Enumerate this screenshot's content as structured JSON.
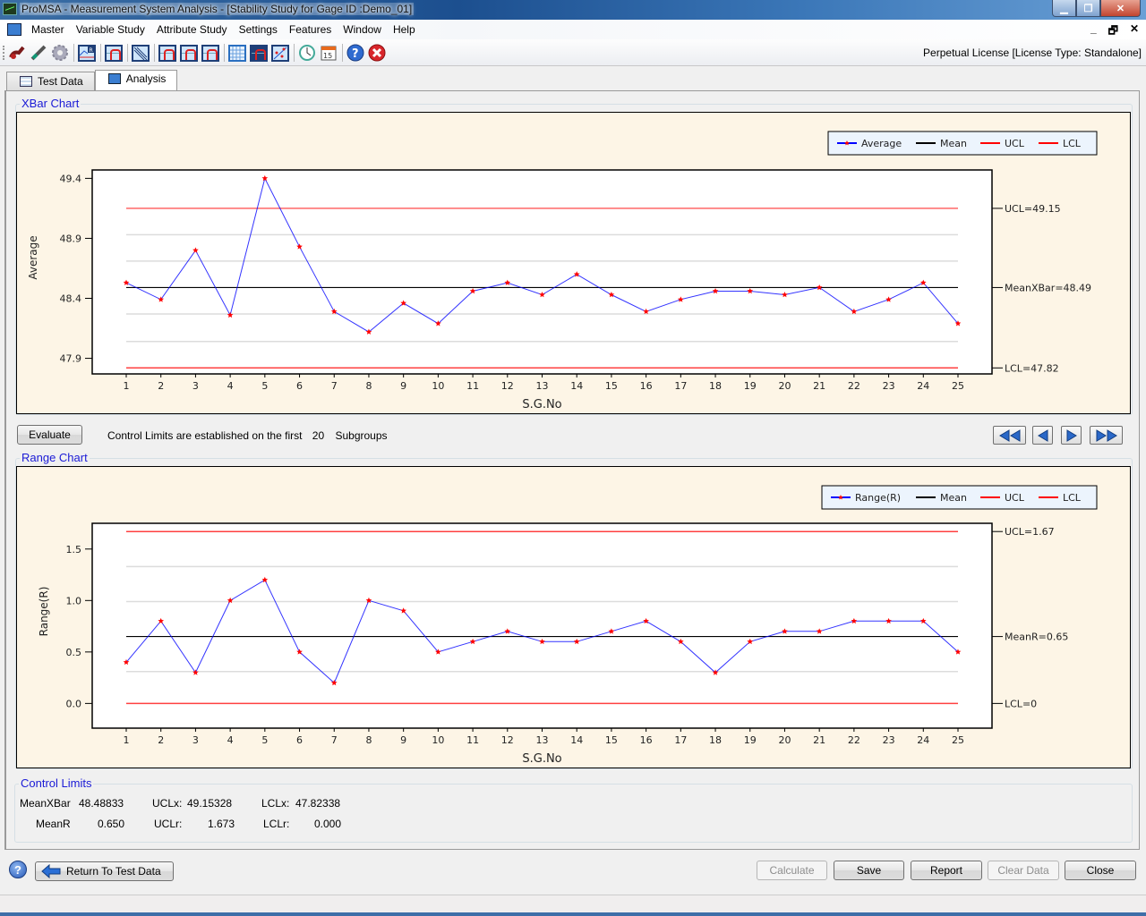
{
  "window": {
    "title": "ProMSA - Measurement System Analysis  - [Stability Study for Gage ID :Demo_01]",
    "controls": [
      "minimize",
      "maximize",
      "close"
    ],
    "mdi_controls": [
      "_",
      "🗗",
      "✕"
    ]
  },
  "menu": {
    "items": [
      "Master",
      "Variable Study",
      "Attribute Study",
      "Settings",
      "Features",
      "Window",
      "Help"
    ]
  },
  "toolbar": {
    "icons": [
      "micrometer-icon",
      "gage-icon",
      "settings-gear-icon",
      "xbar-r-chart-icon",
      "bias-chart-icon",
      "linearity-chart-icon",
      "grr-range-icon",
      "grr-anova-icon",
      "grr-ndc-icon",
      "table-grid-icon",
      "stability-chart-icon",
      "scatter-icon",
      "clock-icon",
      "calendar-icon",
      "help-icon",
      "exit-icon"
    ],
    "calendar_day": "15",
    "license": "Perpetual License [License Type: Standalone]"
  },
  "tabs": [
    {
      "label": "Test Data",
      "active": false
    },
    {
      "label": "Analysis",
      "active": true
    }
  ],
  "xbar_section": {
    "title": "XBar Chart"
  },
  "range_section": {
    "title": "Range Chart"
  },
  "evaluate": {
    "button_label": "Evaluate",
    "text_prefix": "Control Limits are established on the first",
    "subgroups": "20",
    "text_suffix": "Subgroups"
  },
  "nav": [
    "first",
    "previous",
    "next",
    "last"
  ],
  "chart_data": [
    {
      "type": "line",
      "title": "XBar Chart",
      "xlabel": "S.G.No",
      "ylabel": "Average",
      "x": [
        1,
        2,
        3,
        4,
        5,
        6,
        7,
        8,
        9,
        10,
        11,
        12,
        13,
        14,
        15,
        16,
        17,
        18,
        19,
        20,
        21,
        22,
        23,
        24,
        25
      ],
      "series": [
        {
          "name": "Average",
          "color": "#0000ff",
          "marker_color": "#ff0000",
          "values": [
            48.53,
            48.39,
            48.8,
            48.26,
            49.4,
            48.83,
            48.29,
            48.12,
            48.36,
            48.19,
            48.46,
            48.53,
            48.43,
            48.6,
            48.43,
            48.29,
            48.39,
            48.46,
            48.46,
            48.43,
            48.49,
            48.29,
            48.39,
            48.53,
            48.19
          ]
        }
      ],
      "mean": 48.49,
      "ucl": 49.15,
      "lcl": 47.82,
      "mean_color": "#000000",
      "ucl_color": "#ff0000",
      "lcl_color": "#ff0000",
      "right_labels": {
        "ucl": "UCL=49.15",
        "mean": "MeanXBar=48.49",
        "lcl": "LCL=47.82"
      },
      "legend": [
        "Average",
        "Mean",
        "UCL",
        "LCL"
      ],
      "legend_position": "top-right",
      "yticks": [
        47.9,
        48.4,
        48.9,
        49.4
      ],
      "ytick_labels": [
        "47.9",
        "48.4",
        "48.9",
        "49.4"
      ],
      "gridlines": [
        48.04,
        48.27,
        48.71,
        48.93
      ],
      "ylim": [
        47.77,
        49.47
      ],
      "grid": true
    },
    {
      "type": "line",
      "title": "Range Chart",
      "xlabel": "S.G.No",
      "ylabel": "Range(R)",
      "x": [
        1,
        2,
        3,
        4,
        5,
        6,
        7,
        8,
        9,
        10,
        11,
        12,
        13,
        14,
        15,
        16,
        17,
        18,
        19,
        20,
        21,
        22,
        23,
        24,
        25
      ],
      "series": [
        {
          "name": "Range(R)",
          "color": "#0000ff",
          "marker_color": "#ff0000",
          "values": [
            0.4,
            0.8,
            0.3,
            1.0,
            1.2,
            0.5,
            0.2,
            1.0,
            0.9,
            0.5,
            0.6,
            0.7,
            0.6,
            0.6,
            0.7,
            0.8,
            0.6,
            0.3,
            0.6,
            0.7,
            0.7,
            0.8,
            0.8,
            0.8,
            0.5
          ]
        }
      ],
      "mean": 0.65,
      "ucl": 1.67,
      "lcl": 0,
      "mean_color": "#000000",
      "ucl_color": "#ff0000",
      "lcl_color": "#ff0000",
      "right_labels": {
        "ucl": "UCL=1.67",
        "mean": "MeanR=0.65",
        "lcl": "LCL=0"
      },
      "legend": [
        "Range(R)",
        "Mean",
        "UCL",
        "LCL"
      ],
      "legend_position": "top-right",
      "yticks": [
        0.0,
        0.5,
        1.0,
        1.5
      ],
      "ytick_labels": [
        "0.0",
        "0.5",
        "1.0",
        "1.5"
      ],
      "gridlines": [
        0.31,
        0.99,
        1.33
      ],
      "ylim": [
        -0.24,
        1.75
      ],
      "grid": true
    }
  ],
  "control_limits": {
    "title": "Control Limits",
    "row1": [
      {
        "label": "MeanXBar",
        "value": "48.48833"
      },
      {
        "label": "UCLx:",
        "value": "49.15328"
      },
      {
        "label": "LCLx:",
        "value": "47.82338"
      }
    ],
    "row2": [
      {
        "label": "MeanR",
        "value": "0.650"
      },
      {
        "label": "UCLr:",
        "value": "1.673"
      },
      {
        "label": "LCLr:",
        "value": "0.000"
      }
    ]
  },
  "footer": {
    "help": "?",
    "return_label": "Return To Test Data",
    "buttons": [
      {
        "label": "Calculate",
        "enabled": false
      },
      {
        "label": "Save",
        "enabled": true
      },
      {
        "label": "Report",
        "enabled": true
      },
      {
        "label": "Clear Data",
        "enabled": false
      },
      {
        "label": "Close",
        "enabled": true
      }
    ]
  }
}
